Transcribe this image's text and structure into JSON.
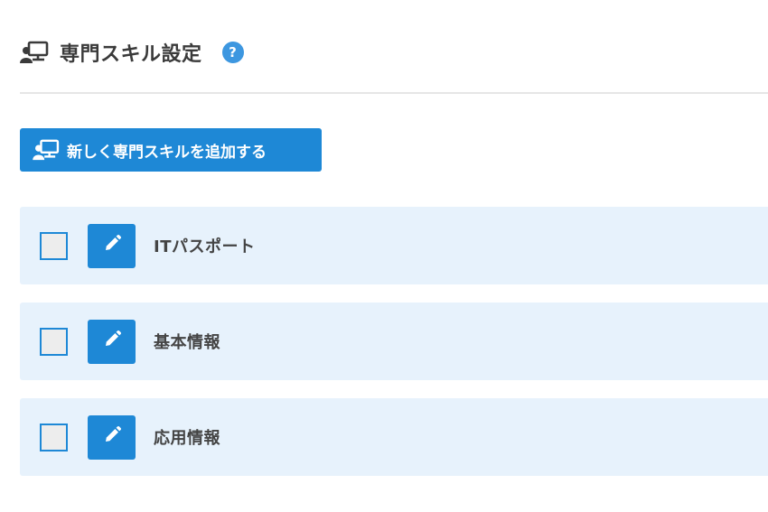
{
  "header": {
    "icon": "person-board-icon",
    "title": "専門スキル設定",
    "help_icon": "question-icon",
    "help_label": "?"
  },
  "toolbar": {
    "add_button_icon": "person-board-icon",
    "add_button_label": "新しく専門スキルを追加する"
  },
  "skills": [
    {
      "name": "ITパスポート",
      "checked": false,
      "edit_icon": "pencil-icon"
    },
    {
      "name": "基本情報",
      "checked": false,
      "edit_icon": "pencil-icon"
    },
    {
      "name": "応用情報",
      "checked": false,
      "edit_icon": "pencil-icon"
    }
  ],
  "colors": {
    "accent": "#1e88d6",
    "row_background": "#e7f2fc",
    "help_background": "#3d97e0",
    "title_text": "#3a3a3a"
  }
}
